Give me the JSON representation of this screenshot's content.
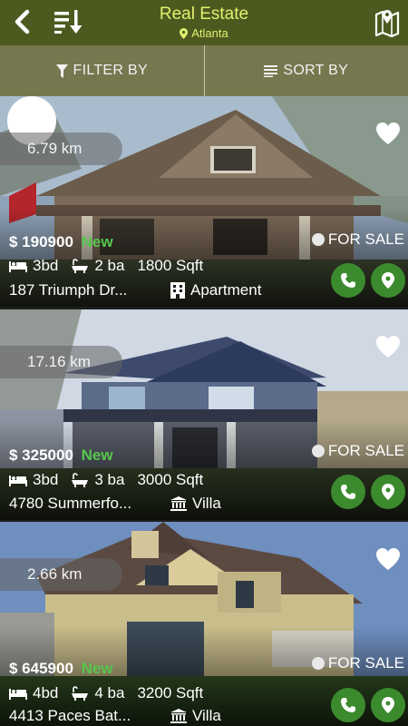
{
  "header": {
    "title": "Real Estate",
    "city": "Atlanta",
    "back_icon": "back-arrow-icon",
    "sort_icon": "sort-down-icon",
    "map_icon": "map-icon"
  },
  "toolbar": {
    "filter_label": "FILTER BY",
    "sort_label": "SORT BY"
  },
  "colors": {
    "header_bg": "#4c5a20",
    "title_text": "#e1f06e",
    "toolbar_bg": "#76774e",
    "new_badge": "#56c74c",
    "action_button": "#3c8a2e"
  },
  "listings": [
    {
      "distance": "6.79 km",
      "price": "$ 190900",
      "badge": "New",
      "status": "FOR SALE",
      "beds": "3bd",
      "baths": "2 ba",
      "area": "1800 Sqft",
      "address": "187 Triumph Dr...",
      "type": "Apartment"
    },
    {
      "distance": "17.16 km",
      "price": "$ 325000",
      "badge": "New",
      "status": "FOR SALE",
      "beds": "3bd",
      "baths": "3 ba",
      "area": "3000 Sqft",
      "address": "4780 Summerfo...",
      "type": "Villa"
    },
    {
      "distance": "2.66 km",
      "price": "$ 645900",
      "badge": "New",
      "status": "FOR SALE",
      "beds": "4bd",
      "baths": "4 ba",
      "area": "3200 Sqft",
      "address": "4413 Paces Bat...",
      "type": "Villa"
    }
  ]
}
